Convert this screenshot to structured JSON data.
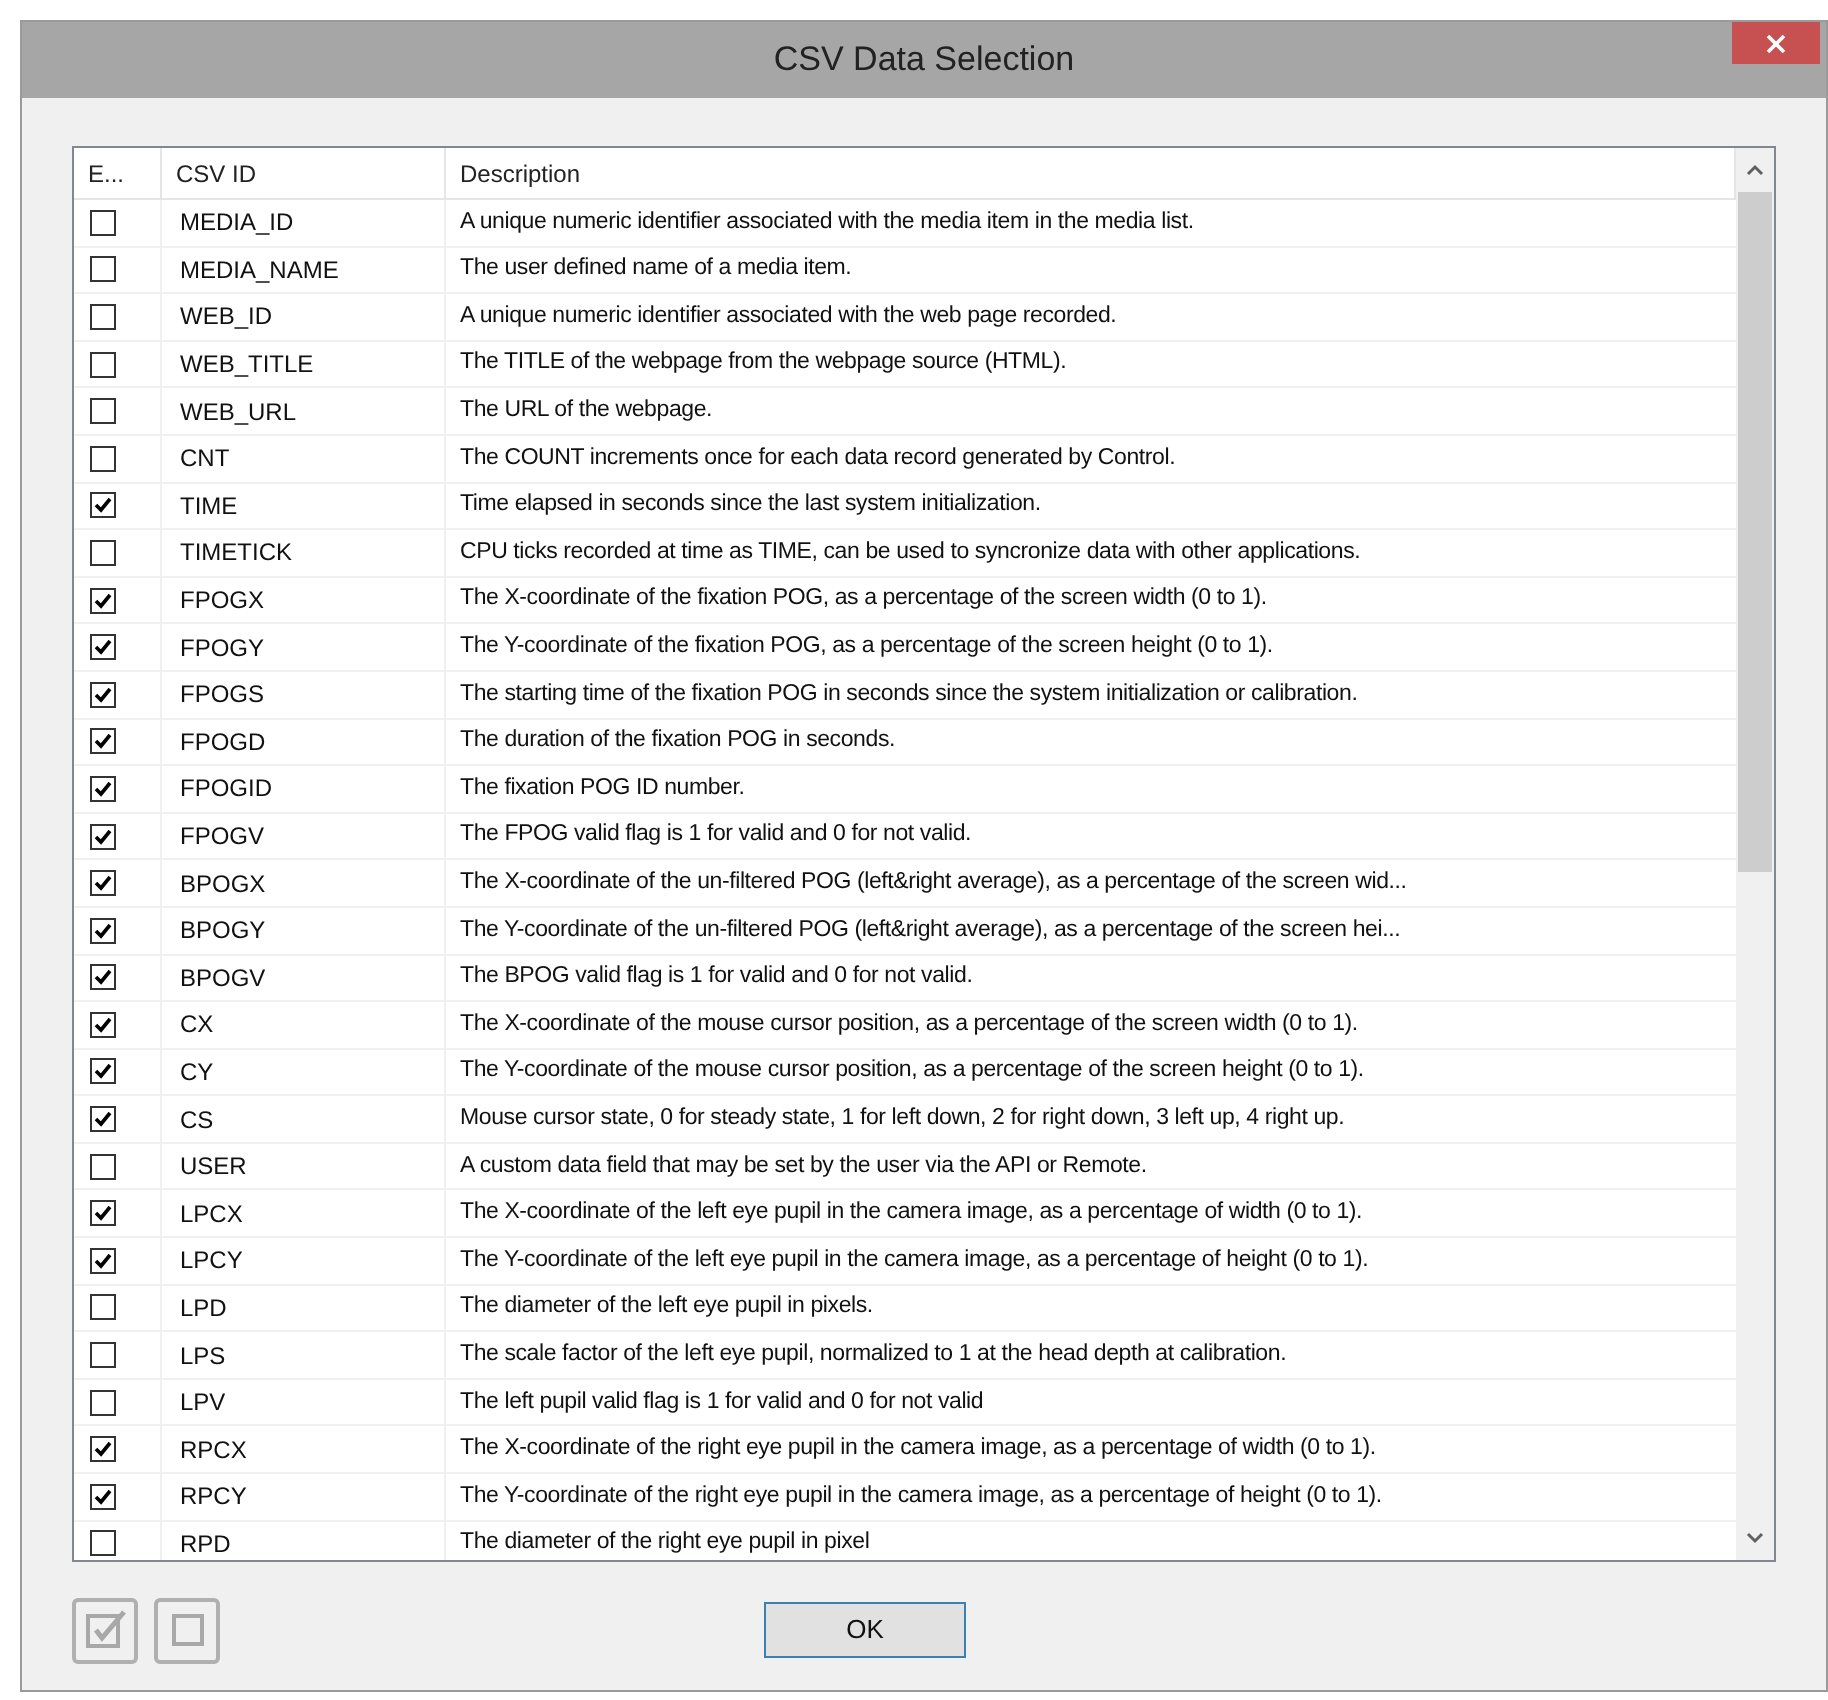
{
  "window": {
    "title": "CSV Data Selection"
  },
  "table": {
    "columns": [
      "E...",
      "CSV ID",
      "Description"
    ],
    "rows": [
      {
        "enabled": false,
        "id": "MEDIA_ID",
        "description": "A unique numeric identifier associated with the media item in the media list."
      },
      {
        "enabled": false,
        "id": "MEDIA_NAME",
        "description": "The user defined name of a media item."
      },
      {
        "enabled": false,
        "id": "WEB_ID",
        "description": "A unique numeric identifier associated with the web page recorded."
      },
      {
        "enabled": false,
        "id": "WEB_TITLE",
        "description": "The TITLE of the webpage from the webpage source (HTML)."
      },
      {
        "enabled": false,
        "id": "WEB_URL",
        "description": "The URL of the webpage."
      },
      {
        "enabled": false,
        "id": "CNT",
        "description": "The COUNT increments once for each data record generated by Control."
      },
      {
        "enabled": true,
        "id": "TIME",
        "description": "Time elapsed in seconds since the last system initialization."
      },
      {
        "enabled": false,
        "id": "TIMETICK",
        "description": "CPU ticks recorded at time as TIME, can be used to syncronize data with other applications."
      },
      {
        "enabled": true,
        "id": "FPOGX",
        "description": "The X-coordinate of the fixation POG, as a percentage of the screen width (0 to 1)."
      },
      {
        "enabled": true,
        "id": "FPOGY",
        "description": "The Y-coordinate of the fixation POG, as a percentage of the screen height (0 to 1)."
      },
      {
        "enabled": true,
        "id": "FPOGS",
        "description": "The starting time of the fixation POG in seconds since the system initialization or calibration."
      },
      {
        "enabled": true,
        "id": "FPOGD",
        "description": "The duration of the fixation POG in seconds."
      },
      {
        "enabled": true,
        "id": "FPOGID",
        "description": "The fixation POG ID number."
      },
      {
        "enabled": true,
        "id": "FPOGV",
        "description": "The FPOG valid flag is 1 for valid and 0 for not valid."
      },
      {
        "enabled": true,
        "id": "BPOGX",
        "description": "The X-coordinate of the un-filtered POG (left&right average), as a percentage of the screen wid..."
      },
      {
        "enabled": true,
        "id": "BPOGY",
        "description": "The Y-coordinate of the un-filtered POG (left&right average), as a percentage of the screen hei..."
      },
      {
        "enabled": true,
        "id": "BPOGV",
        "description": "The BPOG valid flag is 1 for valid and 0 for not valid."
      },
      {
        "enabled": true,
        "id": "CX",
        "description": "The X-coordinate of the mouse cursor position, as a percentage of the screen width (0 to 1)."
      },
      {
        "enabled": true,
        "id": "CY",
        "description": "The Y-coordinate of the mouse cursor position, as a percentage of the screen height (0 to 1)."
      },
      {
        "enabled": true,
        "id": "CS",
        "description": "Mouse cursor state, 0 for steady state, 1 for left down, 2 for right down, 3 left up, 4 right up."
      },
      {
        "enabled": false,
        "id": "USER",
        "description": "A custom data field that may be set by the user via the API or Remote."
      },
      {
        "enabled": true,
        "id": "LPCX",
        "description": "The X-coordinate of the left eye pupil in the camera image, as a percentage of width (0 to 1)."
      },
      {
        "enabled": true,
        "id": "LPCY",
        "description": "The Y-coordinate of the left eye pupil in the camera image, as a percentage of height (0 to 1)."
      },
      {
        "enabled": false,
        "id": "LPD",
        "description": "The diameter of the left eye pupil in pixels."
      },
      {
        "enabled": false,
        "id": "LPS",
        "description": "The scale factor of the left eye pupil, normalized to 1 at the head depth at calibration."
      },
      {
        "enabled": false,
        "id": "LPV",
        "description": "The left pupil valid flag is 1 for valid and 0 for not valid"
      },
      {
        "enabled": true,
        "id": "RPCX",
        "description": "The X-coordinate of the right eye pupil in the camera image, as a percentage of width (0 to 1)."
      },
      {
        "enabled": true,
        "id": "RPCY",
        "description": "The Y-coordinate of the right eye pupil in the camera image, as a percentage of height (0 to 1)."
      },
      {
        "enabled": false,
        "id": "RPD",
        "description": "The diameter of the right eye pupil in pixel"
      }
    ]
  },
  "buttons": [
    "OK"
  ]
}
